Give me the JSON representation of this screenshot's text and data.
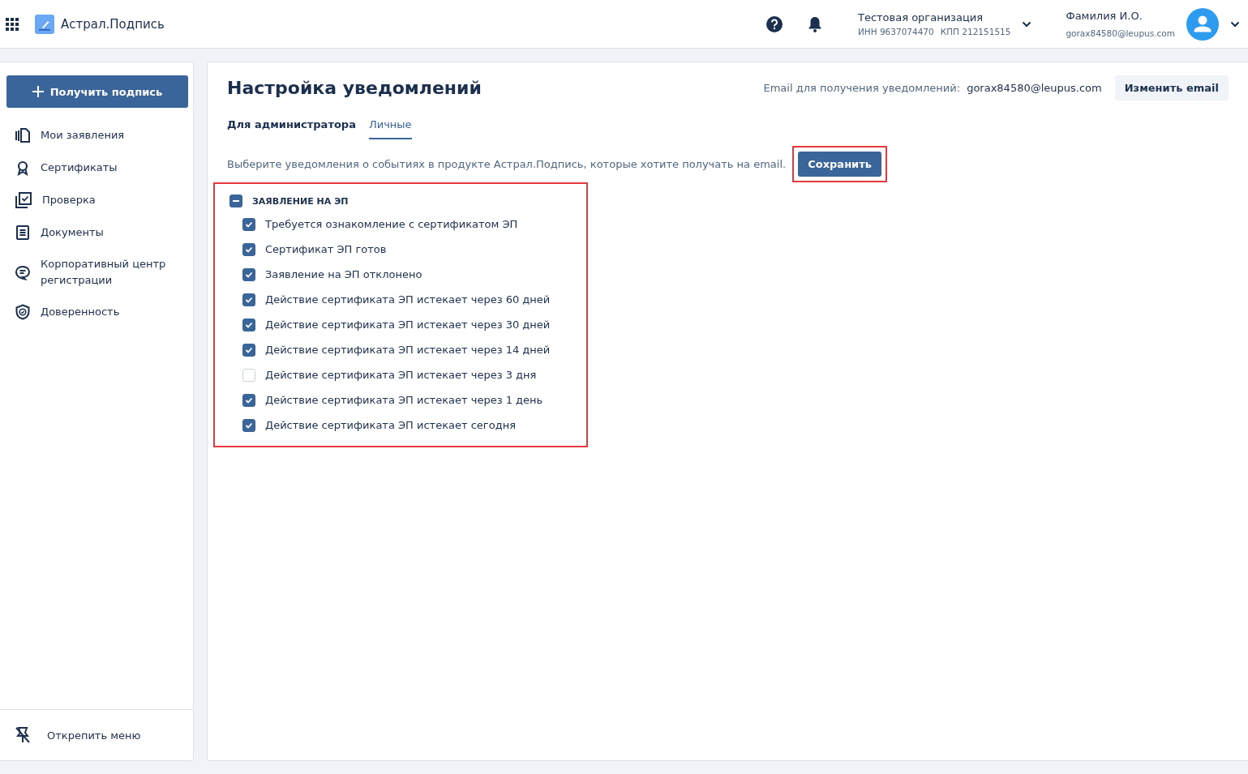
{
  "header": {
    "app_name": "Астрал.Подпись",
    "organization": {
      "name": "Тестовая организация",
      "inn": "ИНН 9637074470",
      "kpp": "КПП 212151515"
    },
    "user": {
      "name": "Фамилия И.О.",
      "email": "gorax84580@leupus.com"
    }
  },
  "sidebar": {
    "primary_button": "Получить подпись",
    "items": [
      {
        "label": "Мои заявления",
        "selected": false
      },
      {
        "label": "Сертификаты",
        "selected": false
      },
      {
        "label": "Проверка",
        "selected": false
      },
      {
        "label": "Документы",
        "selected": false
      },
      {
        "label": "Корпоративный центр регистрации",
        "selected": false
      },
      {
        "label": "Доверенность",
        "selected": false
      }
    ],
    "unpin": "Открепить меню"
  },
  "page": {
    "title": "Настройка уведомлений",
    "email_label": "Email для получения уведомлений:",
    "email": "gorax84580@leupus.com",
    "change_email_button": "Изменить email",
    "tabs": [
      {
        "label": "Для администратора",
        "selected": false
      },
      {
        "label": "Личные",
        "selected": true
      }
    ],
    "hint": "Выберите уведомления о событиях в продукте Астрал.Подпись, которые хотите получать на email.",
    "save_button": {
      "label": "Сохранить",
      "highlighted": true
    },
    "group": {
      "label": "ЗАЯВЛЕНИЕ НА ЭП",
      "indeterminate": true,
      "highlighted": true,
      "options": [
        {
          "label": "Требуется ознакомление с сертификатом ЭП",
          "checked": true
        },
        {
          "label": "Сертификат ЭП готов",
          "checked": true
        },
        {
          "label": "Заявление на ЭП отклонено",
          "checked": true
        },
        {
          "label": "Действие сертификата ЭП истекает через 60 дней",
          "checked": true
        },
        {
          "label": "Действие сертификата ЭП истекает через 30 дней",
          "checked": true
        },
        {
          "label": "Действие сертификата ЭП истекает через 14 дней",
          "checked": true
        },
        {
          "label": "Действие сертификата ЭП истекает через 3 дня",
          "checked": false
        },
        {
          "label": "Действие сертификата ЭП истекает через 1 день",
          "checked": true
        },
        {
          "label": "Действие сертификата ЭП истекает сегодня",
          "checked": true
        }
      ]
    }
  }
}
